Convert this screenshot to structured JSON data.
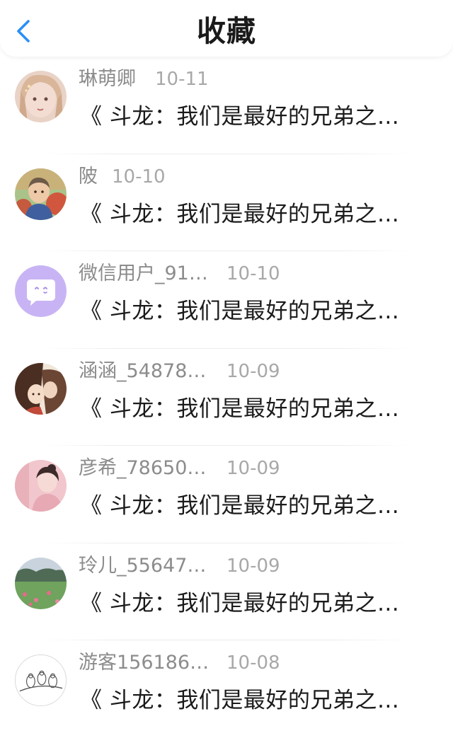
{
  "header": {
    "title": "收藏",
    "back_icon": "chevron-left-icon",
    "accent_color": "#2a8ff7"
  },
  "items": [
    {
      "name": "琳萌卿",
      "date": "10-11",
      "preview": "《 斗龙：我们是最好的兄弟之…",
      "avatar": "girl-portrait-avatar"
    },
    {
      "name": "陂",
      "date": "10-10",
      "preview": "《 斗龙：我们是最好的兄弟之…",
      "avatar": "child-photo-avatar"
    },
    {
      "name": "微信用户_91…",
      "date": "10-10",
      "preview": "《 斗龙：我们是最好的兄弟之…",
      "avatar": "chat-bubble-default-avatar"
    },
    {
      "name": "涵涵_54878…",
      "date": "10-09",
      "preview": "《 斗龙：我们是最好的兄弟之…",
      "avatar": "anime-couple-avatar"
    },
    {
      "name": "彦希_78650…",
      "date": "10-09",
      "preview": "《 斗龙：我们是最好的兄弟之…",
      "avatar": "pink-girl-avatar"
    },
    {
      "name": "玲儿_55647…",
      "date": "10-09",
      "preview": "《 斗龙：我们是最好的兄弟之…",
      "avatar": "landscape-lotus-avatar"
    },
    {
      "name": "游客156186…",
      "date": "10-08",
      "preview": "《 斗龙：我们是最好的兄弟之…",
      "avatar": "birds-sketch-avatar"
    }
  ]
}
